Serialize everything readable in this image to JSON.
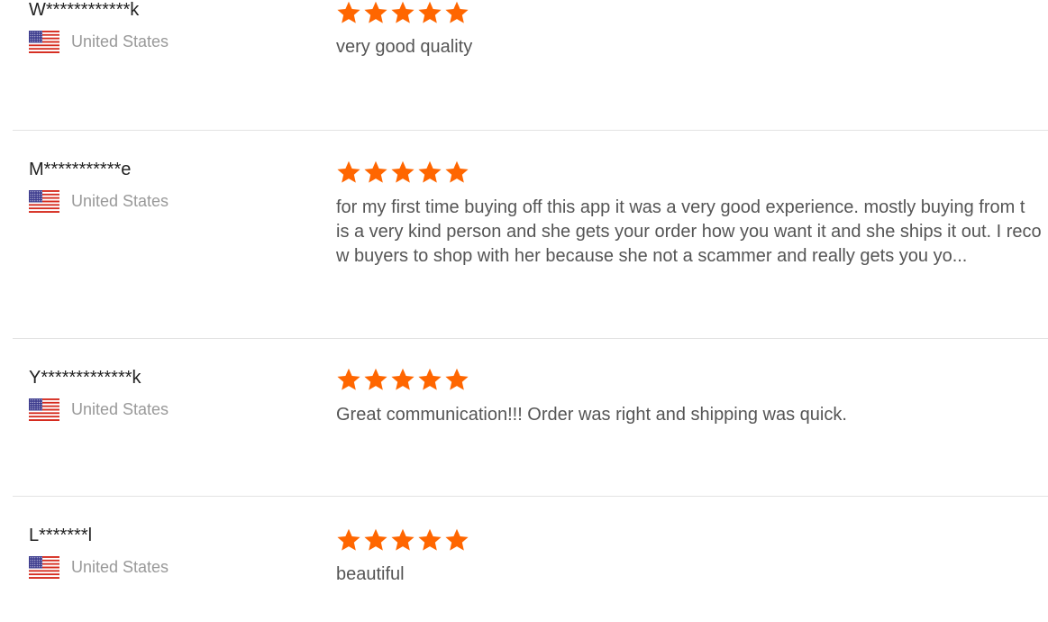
{
  "theme": {
    "star_color": "#ff6600",
    "separator_color": "#e3e3e3",
    "text_color": "#555555",
    "name_color": "#222222",
    "country_color": "#999999"
  },
  "reviews": [
    {
      "reviewer_name": "W************k",
      "country": "United States",
      "flag_icon": "us-flag-icon",
      "rating": 5,
      "text_lines": [
        "very good quality"
      ]
    },
    {
      "reviewer_name": "M***********e",
      "country": "United States",
      "flag_icon": "us-flag-icon",
      "rating": 5,
      "text_lines": [
        "for my first time buying off this app it was a very good experience. mostly buying from t",
        "is a very kind person and she gets your order how you want it and she ships it out. I reco",
        "w buyers to shop with her because she not a scammer and really gets you yo..."
      ]
    },
    {
      "reviewer_name": "Y*************k",
      "country": "United States",
      "flag_icon": "us-flag-icon",
      "rating": 5,
      "text_lines": [
        "Great communication!!! Order was right and shipping was quick."
      ]
    },
    {
      "reviewer_name": "L*******l",
      "country": "United States",
      "flag_icon": "us-flag-icon",
      "rating": 5,
      "text_lines": [
        "beautiful"
      ]
    }
  ]
}
